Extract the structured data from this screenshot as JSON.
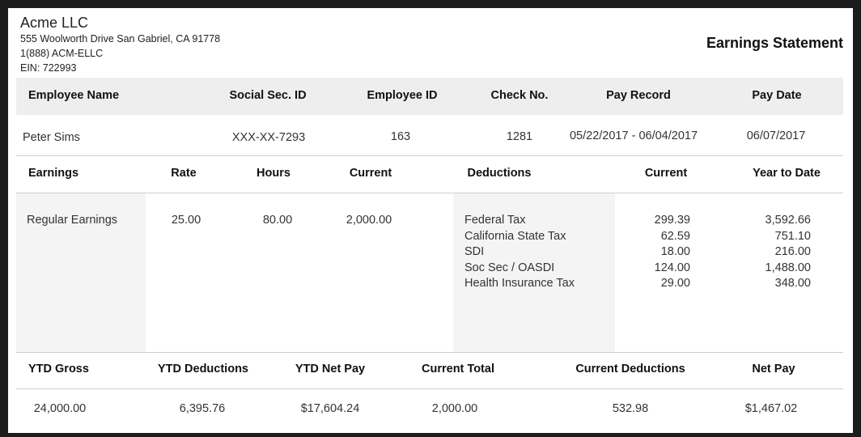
{
  "company": {
    "name": "Acme LLC",
    "address": "555 Woolworth Drive San Gabriel, CA 91778",
    "phone": "1(888) ACM-ELLC",
    "ein": "EIN: 722993"
  },
  "document_title": "Earnings Statement",
  "employee_table": {
    "headers": {
      "name": "Employee Name",
      "ssn": "Social Sec. ID",
      "employee_id": "Employee ID",
      "check_no": "Check No.",
      "pay_record": "Pay Record",
      "pay_date": "Pay Date"
    },
    "row": {
      "name": "Peter Sims",
      "ssn": "XXX-XX-7293",
      "employee_id": "163",
      "check_no": "1281",
      "pay_record": "05/22/2017 - 06/04/2017",
      "pay_date": "06/07/2017"
    }
  },
  "earnings_table": {
    "headers": {
      "earnings": "Earnings",
      "rate": "Rate",
      "hours": "Hours",
      "current": "Current",
      "deductions": "Deductions",
      "ded_current": "Current",
      "ytd": "Year to Date"
    },
    "earnings_row": {
      "label": "Regular Earnings",
      "rate": "25.00",
      "hours": "80.00",
      "current": "2,000.00"
    },
    "deductions": [
      {
        "label": "Federal Tax",
        "current": "299.39",
        "ytd": "3,592.66"
      },
      {
        "label": "California State Tax",
        "current": "62.59",
        "ytd": "751.10"
      },
      {
        "label": "SDI",
        "current": "18.00",
        "ytd": "216.00"
      },
      {
        "label": "Soc Sec / OASDI",
        "current": "124.00",
        "ytd": "1,488.00"
      },
      {
        "label": "Health Insurance Tax",
        "current": "29.00",
        "ytd": "348.00"
      }
    ]
  },
  "totals_table": {
    "headers": {
      "ytd_gross": "YTD Gross",
      "ytd_deductions": "YTD Deductions",
      "ytd_net_pay": "YTD Net Pay",
      "current_total": "Current Total",
      "current_deductions": "Current Deductions",
      "net_pay": "Net Pay"
    },
    "values": {
      "ytd_gross": "24,000.00",
      "ytd_deductions": "6,395.76",
      "ytd_net_pay": "$17,604.24",
      "current_total": "2,000.00",
      "current_deductions": "532.98",
      "net_pay": "$1,467.02"
    }
  }
}
